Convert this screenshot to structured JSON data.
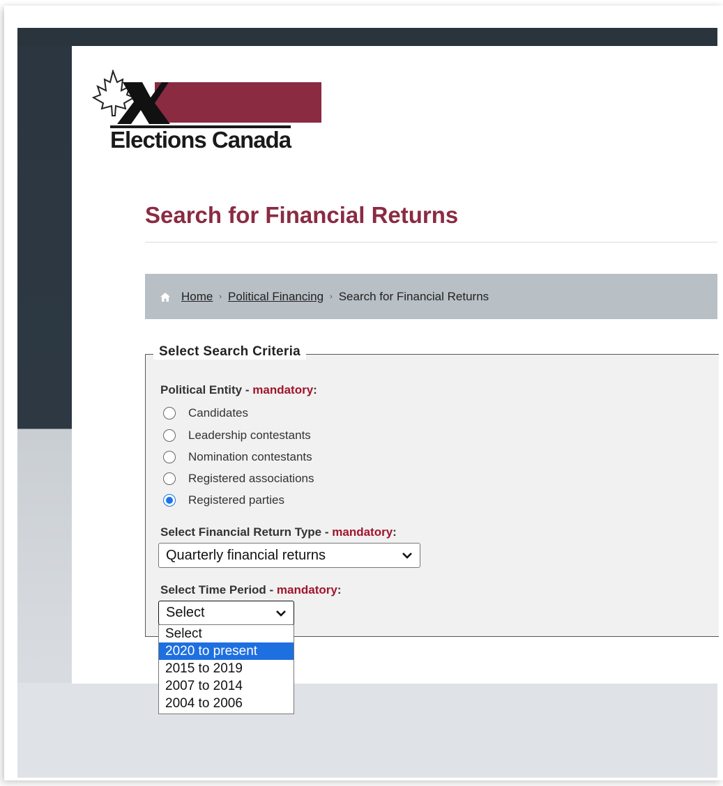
{
  "logo": {
    "text": "Elections Canada"
  },
  "page": {
    "title": "Search for Financial Returns"
  },
  "breadcrumb": {
    "home": "Home",
    "level2": "Political Financing",
    "current": "Search for Financial Returns",
    "separator": "›"
  },
  "criteria": {
    "legend": "Select Search Criteria",
    "entity": {
      "label": "Political Entity",
      "dash": " - ",
      "mandatory": "mandatory",
      "colon": ":",
      "options": [
        {
          "label": "Candidates",
          "checked": false
        },
        {
          "label": "Leadership contestants",
          "checked": false
        },
        {
          "label": "Nomination contestants",
          "checked": false
        },
        {
          "label": "Registered associations",
          "checked": false
        },
        {
          "label": "Registered parties",
          "checked": true
        }
      ]
    },
    "return_type": {
      "label": "Select Financial Return Type",
      "dash": " - ",
      "mandatory": "mandatory",
      "colon": ":",
      "selected": "Quarterly financial returns"
    },
    "time_period": {
      "label": "Select Time Period",
      "dash": " - ",
      "mandatory": "mandatory",
      "colon": ":",
      "selected": "Select",
      "options": [
        "Select",
        "2020 to present",
        "2015 to 2019",
        "2007 to 2014",
        "2004 to 2006"
      ],
      "highlighted_index": 1
    }
  },
  "colors": {
    "brand": "#8a2b42",
    "mandatory": "#a0152b",
    "highlight": "#1e6fe0",
    "radio_checked": "#1a73e8"
  }
}
